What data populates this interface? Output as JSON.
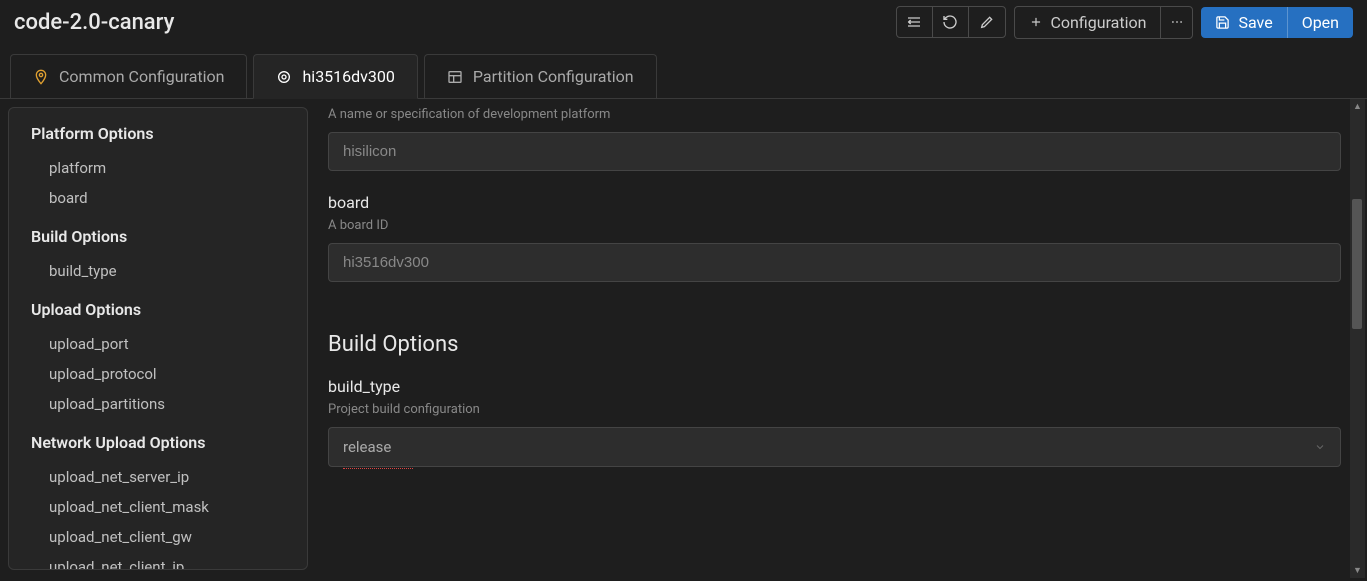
{
  "header": {
    "title": "code-2.0-canary",
    "config_label": "Configuration",
    "save_label": "Save",
    "open_label": "Open"
  },
  "tabs": [
    {
      "label": "Common Configuration",
      "icon": "pin"
    },
    {
      "label": "hi3516dv300",
      "icon": "target"
    },
    {
      "label": "Partition Configuration",
      "icon": "layout"
    }
  ],
  "sidebar": {
    "groups": [
      {
        "title": "Platform Options",
        "items": [
          "platform",
          "board"
        ]
      },
      {
        "title": "Build Options",
        "items": [
          "build_type"
        ]
      },
      {
        "title": "Upload Options",
        "items": [
          "upload_port",
          "upload_protocol",
          "upload_partitions"
        ]
      },
      {
        "title": "Network Upload Options",
        "items": [
          "upload_net_server_ip",
          "upload_net_client_mask",
          "upload_net_client_gw",
          "upload_net_client_ip"
        ]
      }
    ]
  },
  "main": {
    "platform_desc": "A name or specification of development platform",
    "platform_value": "hisilicon",
    "board_label": "board",
    "board_desc": "A board ID",
    "board_value": "hi3516dv300",
    "build_section": "Build Options",
    "build_type_label": "build_type",
    "build_type_desc": "Project build configuration",
    "build_type_value": "release"
  }
}
